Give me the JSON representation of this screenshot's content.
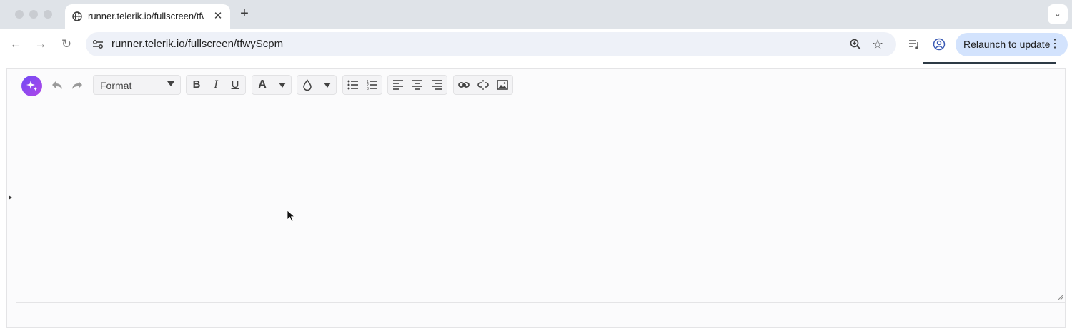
{
  "browser": {
    "tab": {
      "title": "runner.telerik.io/fullscreen/tfwyScpm",
      "close_symbol": "✕"
    },
    "new_tab_symbol": "+",
    "tab_search_symbol": "⌄",
    "nav": {
      "back": "←",
      "forward": "→",
      "reload": "↻"
    },
    "address": {
      "url": "runner.telerik.io/fullscreen/tfwyScpm",
      "star": "☆"
    },
    "relaunch": {
      "label": "Relaunch to update",
      "menu_symbol": "⋮"
    }
  },
  "editor": {
    "format_dropdown": {
      "value": "Format"
    },
    "bold_label": "B",
    "italic_label": "I",
    "underline_label": "U",
    "font_color_label": "A",
    "content": ""
  }
}
